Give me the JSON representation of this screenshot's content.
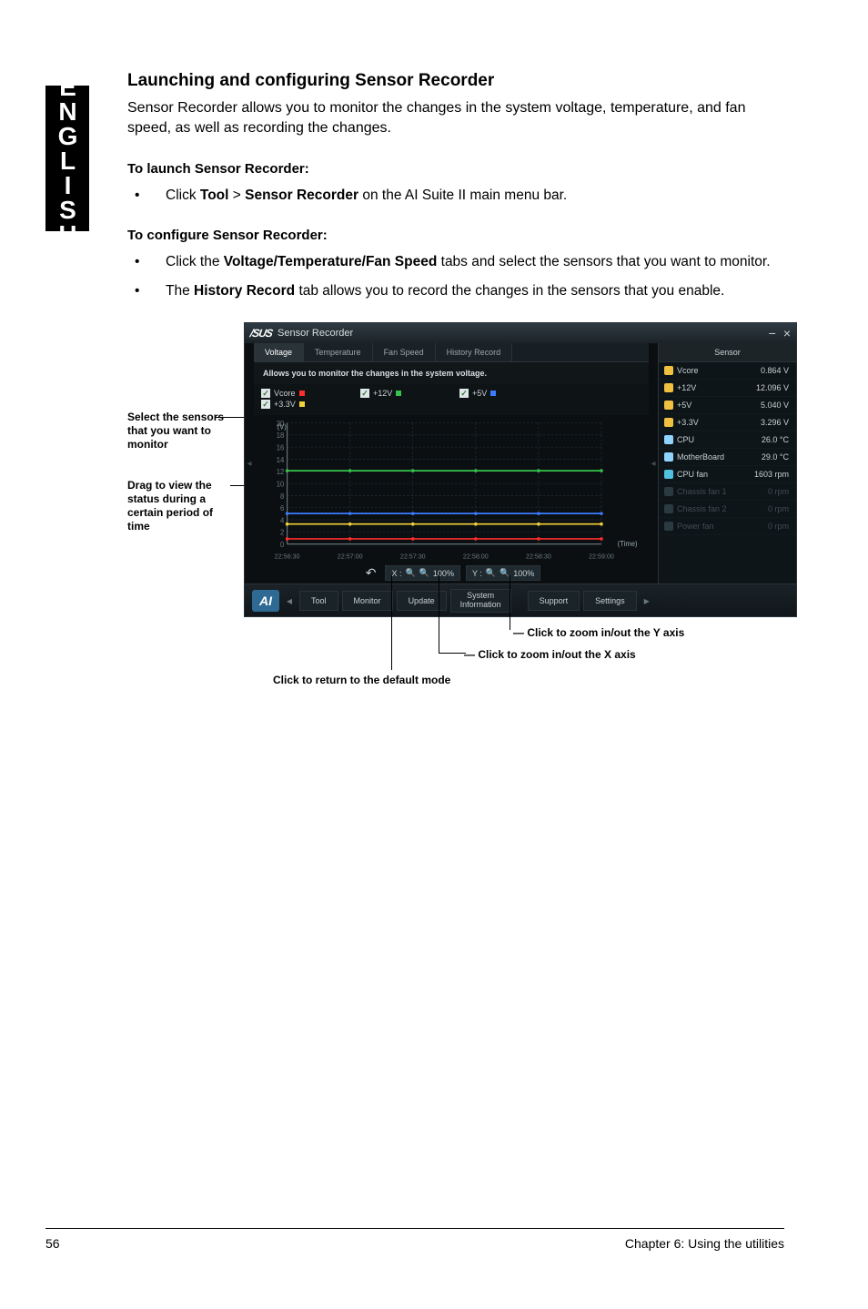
{
  "side_tab": "ENGLISH",
  "heading": "Launching and configuring Sensor Recorder",
  "intro": "Sensor Recorder allows you to monitor the changes in the system voltage, temperature, and fan speed, as well as recording the changes.",
  "launch_hdr": "To launch Sensor Recorder:",
  "launch_pre": "Click ",
  "launch_tool": "Tool",
  "launch_gt": " > ",
  "launch_sr": "Sensor Recorder",
  "launch_post": " on the AI Suite II main menu bar.",
  "config_hdr": "To configure Sensor Recorder:",
  "cfg1_pre": "Click the ",
  "cfg1_b": "Voltage/Temperature/Fan Speed",
  "cfg1_post": " tabs and select the sensors that you want to monitor.",
  "cfg2_pre": "The ",
  "cfg2_b": "History Record",
  "cfg2_post": " tab allows you to record the changes in the sensors that you enable.",
  "callout_select": "Select the sensors that you want to monitor",
  "callout_drag": "Drag to view the status during a certain period of time",
  "callout_y": "Click to zoom in/out the Y axis",
  "callout_x": "Click to zoom in/out the X axis",
  "callout_default": "Click to return to the default mode",
  "window": {
    "brand": "/SUS",
    "title": "Sensor Recorder",
    "tabs": {
      "voltage": "Voltage",
      "temperature": "Temperature",
      "fan": "Fan Speed",
      "history": "History Record"
    },
    "desc": "Allows you to monitor the changes in the system voltage.",
    "checks": {
      "vcore": "Vcore",
      "p12v": "+12V",
      "p5v": "+5V",
      "p33v": "+3.3V"
    },
    "y_label": "(V)",
    "time_label": "(Time)",
    "zoom": {
      "x_label": "X :",
      "x_val": "100%",
      "y_label": "Y :",
      "y_val": "100%"
    },
    "sensor_hdr": "Sensor",
    "sensors": [
      {
        "name": "Vcore",
        "value": "0.864",
        "unit": "V",
        "color": "#f0c040"
      },
      {
        "name": "+12V",
        "value": "12.096",
        "unit": "V",
        "color": "#f0c040"
      },
      {
        "name": "+5V",
        "value": "5.040",
        "unit": "V",
        "color": "#f0c040"
      },
      {
        "name": "+3.3V",
        "value": "3.296",
        "unit": "V",
        "color": "#f0c040"
      },
      {
        "name": "CPU",
        "value": "26.0",
        "unit": "°C",
        "color": "#8fd4ff"
      },
      {
        "name": "MotherBoard",
        "value": "29.0",
        "unit": "°C",
        "color": "#8fd4ff"
      },
      {
        "name": "CPU fan",
        "value": "1603",
        "unit": "rpm",
        "color": "#4fc0e0"
      },
      {
        "name": "Chassis fan 1",
        "value": "0",
        "unit": "rpm",
        "dim": true,
        "color": "#2a3a40"
      },
      {
        "name": "Chassis fan 2",
        "value": "0",
        "unit": "rpm",
        "dim": true,
        "color": "#2a3a40"
      },
      {
        "name": "Power fan",
        "value": "0",
        "unit": "rpm",
        "dim": true,
        "color": "#2a3a40"
      }
    ],
    "bottom": {
      "ai": "AI",
      "tool": "Tool",
      "monitor": "Monitor",
      "update": "Update",
      "sys1": "System",
      "sys2": "Information",
      "support": "Support",
      "settings": "Settings"
    }
  },
  "chart_data": {
    "type": "line",
    "title": "",
    "xlabel": "(Time)",
    "ylabel": "(V)",
    "ylim": [
      0,
      20
    ],
    "y_ticks": [
      0,
      2,
      4,
      6,
      8,
      10,
      12,
      14,
      16,
      18,
      20
    ],
    "x_ticks": [
      "22:56:30",
      "22:57:00",
      "22:57:30",
      "22:58:00",
      "22:58:30",
      "22:59:00"
    ],
    "series": [
      {
        "name": "Vcore",
        "color": "#ff2d2d",
        "values": [
          0.86,
          0.86,
          0.86,
          0.86,
          0.86,
          0.86
        ]
      },
      {
        "name": "+12V",
        "color": "#35c24a",
        "values": [
          12.1,
          12.1,
          12.1,
          12.1,
          12.1,
          12.1
        ]
      },
      {
        "name": "+5V",
        "color": "#3a7bff",
        "values": [
          5.04,
          5.04,
          5.04,
          5.04,
          5.04,
          5.04
        ]
      },
      {
        "name": "+3.3V",
        "color": "#f2d23a",
        "values": [
          3.3,
          3.3,
          3.3,
          3.3,
          3.3,
          3.3
        ]
      }
    ]
  },
  "footer": {
    "page": "56",
    "chapter": "Chapter 6: Using the utilities"
  }
}
